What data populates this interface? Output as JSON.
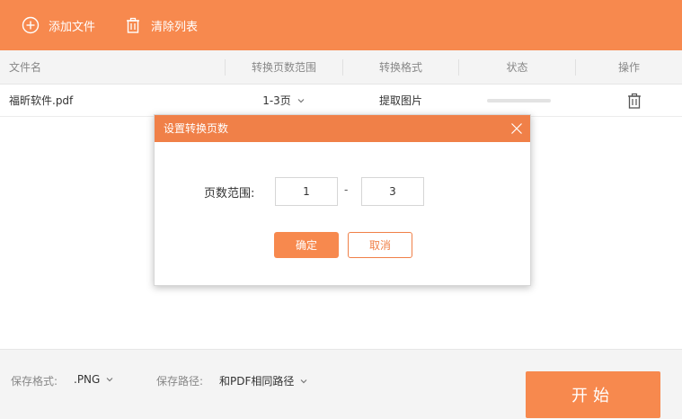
{
  "toolbar": {
    "add_file_label": "添加文件",
    "add_file_icon": "plus-circle-icon",
    "clear_list_label": "清除列表",
    "clear_list_icon": "trash-icon"
  },
  "table": {
    "columns": [
      "文件名",
      "转换页数范围",
      "转换格式",
      "状态",
      "操作"
    ],
    "rows": [
      {
        "file_name": "福昕软件.pdf",
        "page_range": "1-3页",
        "format": "提取图片",
        "progress": 0,
        "action_icon": "trash-icon"
      }
    ]
  },
  "footer": {
    "format_label": "保存格式:",
    "format_value": ".PNG",
    "path_label": "保存路径:",
    "path_value": "和PDF相同路径",
    "start_label": "开始"
  },
  "dialog": {
    "title": "设置转换页数",
    "range_label": "页数范围:",
    "from_value": "1",
    "separator": "-",
    "to_value": "3",
    "ok_label": "确定",
    "cancel_label": "取消",
    "close_icon": "close-icon"
  },
  "colors": {
    "accent": "#f7894e",
    "dialog_header": "#f08048",
    "header_bg": "#f4f4f4"
  }
}
